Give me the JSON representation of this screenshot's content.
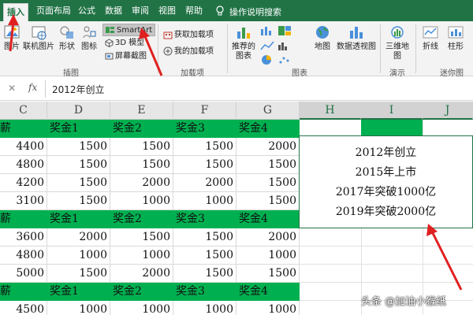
{
  "ribbon_tabs": [
    {
      "label": "插入",
      "active": true
    },
    {
      "label": "页面布局"
    },
    {
      "label": "公式"
    },
    {
      "label": "数据"
    },
    {
      "label": "审阅"
    },
    {
      "label": "视图"
    },
    {
      "label": "帮助"
    }
  ],
  "tell_me": "操作说明搜索",
  "illustrations": {
    "picture": "图片",
    "online_picture": "联机图片",
    "shapes": "形状",
    "icons": "图标",
    "smartart": "SmartArt",
    "model3d": "3D 模型",
    "screenshot": "屏幕截图",
    "group_label": "插图"
  },
  "addins": {
    "get_addins": "获取加载项",
    "my_addins": "我的加载项",
    "group_label": "加载项"
  },
  "charts": {
    "recommended": "推荐的图表",
    "maps": "地图",
    "pivot_chart": "数据透视图",
    "group_label": "图表"
  },
  "tours": {
    "map3d": "三维地图",
    "group_label": "演示"
  },
  "sparklines": {
    "line": "折线",
    "column": "柱形",
    "group_label": "迷你图"
  },
  "formula_bar": {
    "cancel": "✕",
    "fx": "fx",
    "value": "2012年创立"
  },
  "columns": [
    "C",
    "D",
    "E",
    "F",
    "G",
    "H",
    "I",
    "J"
  ],
  "header_row": [
    "薪",
    "奖金1",
    "奖金2",
    "奖金3",
    "奖金4"
  ],
  "rows": [
    {
      "type": "header",
      "cells": [
        "薪",
        "奖金1",
        "奖金2",
        "奖金3",
        "奖金4"
      ]
    },
    {
      "type": "data",
      "cells": [
        "4400",
        "1500",
        "1500",
        "1500",
        "2000"
      ]
    },
    {
      "type": "data",
      "cells": [
        "4800",
        "1500",
        "1500",
        "1500",
        "1500"
      ]
    },
    {
      "type": "data",
      "cells": [
        "4200",
        "1500",
        "2000",
        "2000",
        "1500"
      ]
    },
    {
      "type": "data",
      "cells": [
        "3100",
        "1500",
        "1000",
        "1000",
        "1500"
      ]
    },
    {
      "type": "header",
      "cells": [
        "薪",
        "奖金1",
        "奖金2",
        "奖金3",
        "奖金4"
      ]
    },
    {
      "type": "data",
      "cells": [
        "3600",
        "2000",
        "1500",
        "1500",
        "2000"
      ]
    },
    {
      "type": "data",
      "cells": [
        "4800",
        "1000",
        "1000",
        "1500",
        "1000"
      ]
    },
    {
      "type": "data",
      "cells": [
        "5000",
        "1500",
        "2000",
        "1500",
        "1500"
      ]
    },
    {
      "type": "header",
      "cells": [
        "薪",
        "奖金1",
        "奖金2",
        "奖金3",
        "奖金4"
      ]
    },
    {
      "type": "data",
      "cells": [
        "4500",
        "1000",
        "1000",
        "1000",
        "1000"
      ]
    }
  ],
  "textbox_lines": [
    "2012年创立",
    "2015年上市",
    "2017年突破1000亿",
    "2019年突破2000亿"
  ],
  "watermark": "头条 @加油小猴纸",
  "colors": {
    "excel_green": "#217346",
    "fill_green": "#00b050",
    "arrow_red": "#e02020"
  }
}
